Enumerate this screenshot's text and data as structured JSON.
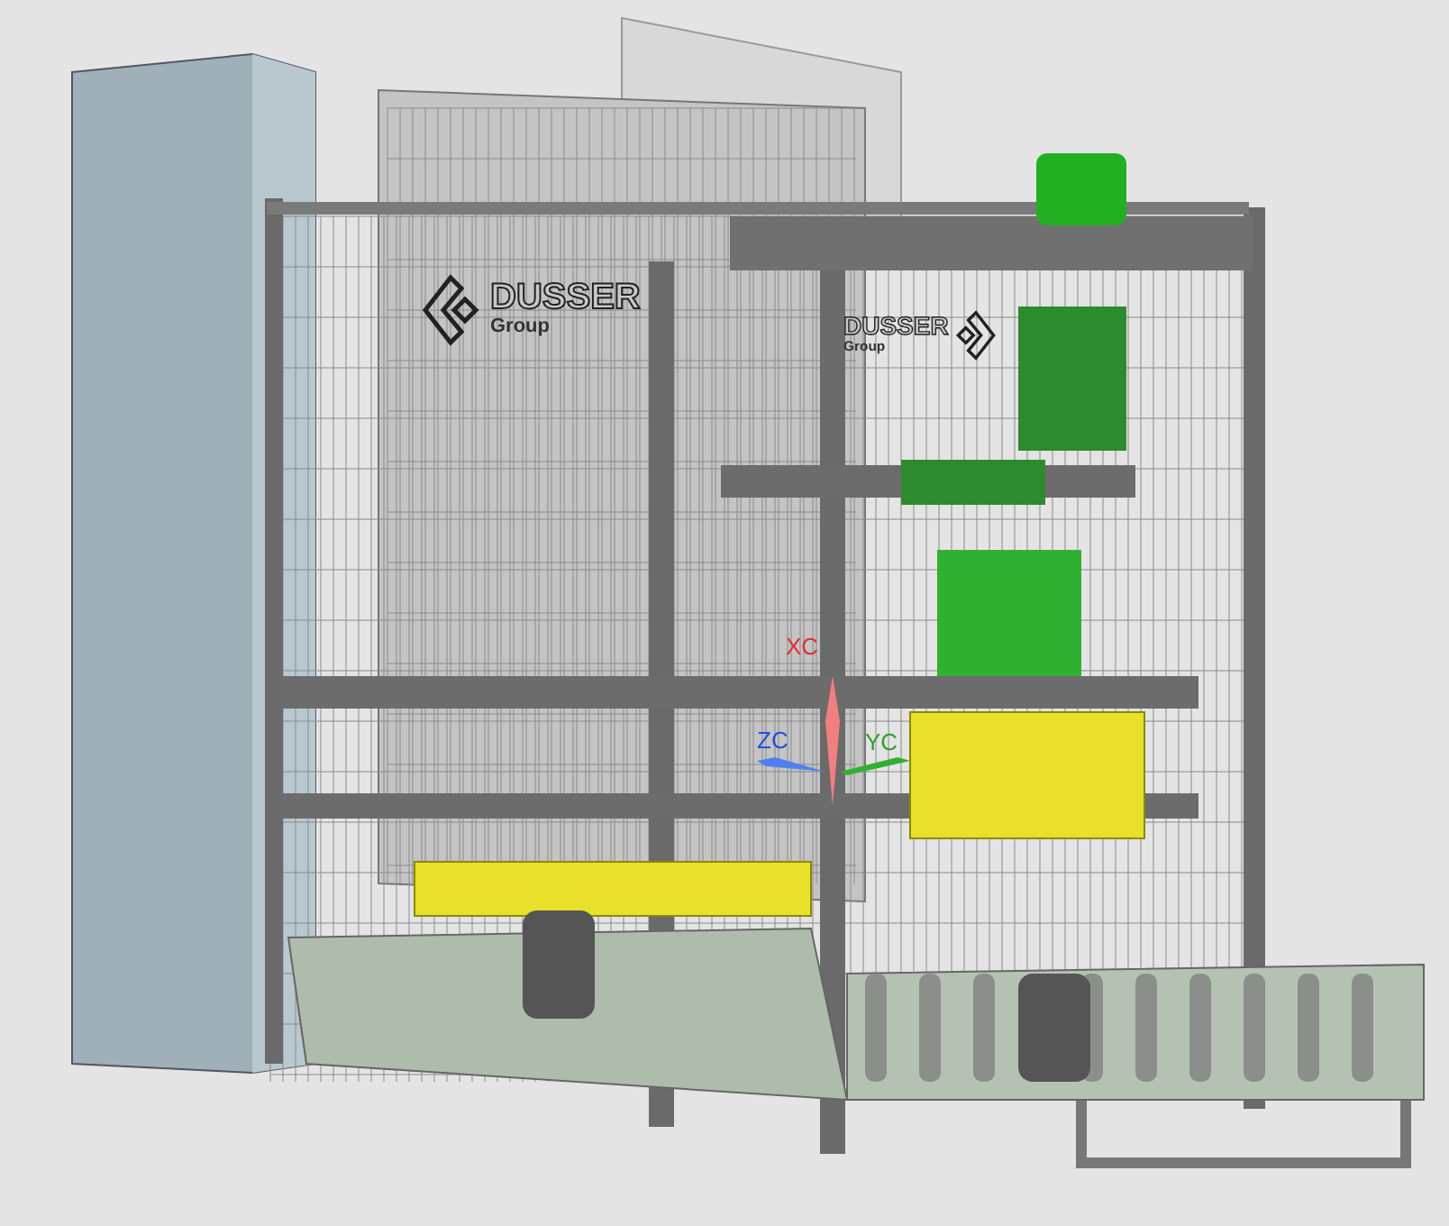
{
  "viewport": {
    "logos": [
      {
        "kind": "front",
        "name": "DUSSER",
        "tagline": "Group"
      },
      {
        "kind": "back",
        "name": "DUSSER",
        "tagline": "Group"
      }
    ],
    "triad": {
      "axes": [
        {
          "kind": "up",
          "label": "XC",
          "color": "#e03030"
        },
        {
          "kind": "left",
          "label": "ZC",
          "color": "#2050e0"
        },
        {
          "kind": "right",
          "label": "YC",
          "color": "#30a030"
        }
      ]
    }
  }
}
